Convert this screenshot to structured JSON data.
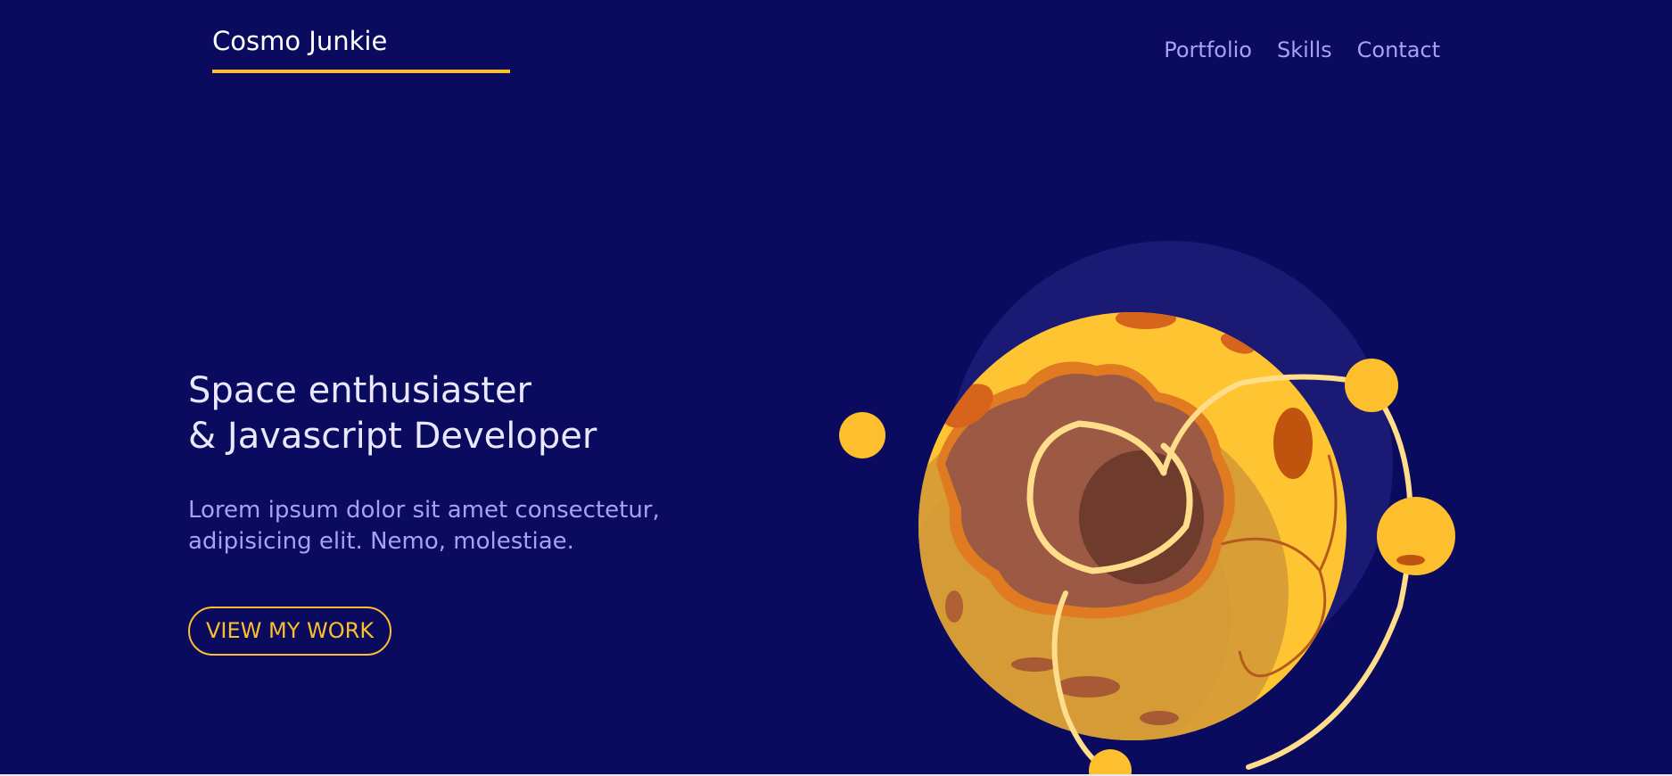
{
  "header": {
    "logo_text": "Cosmo Junkie",
    "nav": [
      {
        "label": "Portfolio"
      },
      {
        "label": "Skills"
      },
      {
        "label": "Contact"
      }
    ]
  },
  "hero": {
    "headline_line1": "Space enthusiaster",
    "headline_line2": "& Javascript Developer",
    "subtext_line1": "Lorem ipsum dolor sit amet consectetur,",
    "subtext_line2": "adipisicing elit. Nemo, molestiae.",
    "cta_label": "VIEW MY WORK"
  },
  "colors": {
    "background": "#0a0a5e",
    "accent": "#fdbf2d",
    "nav_link": "#a4a3f3",
    "headline": "#e9e8ff"
  },
  "illustration": {
    "icon": "planet-illustration"
  }
}
